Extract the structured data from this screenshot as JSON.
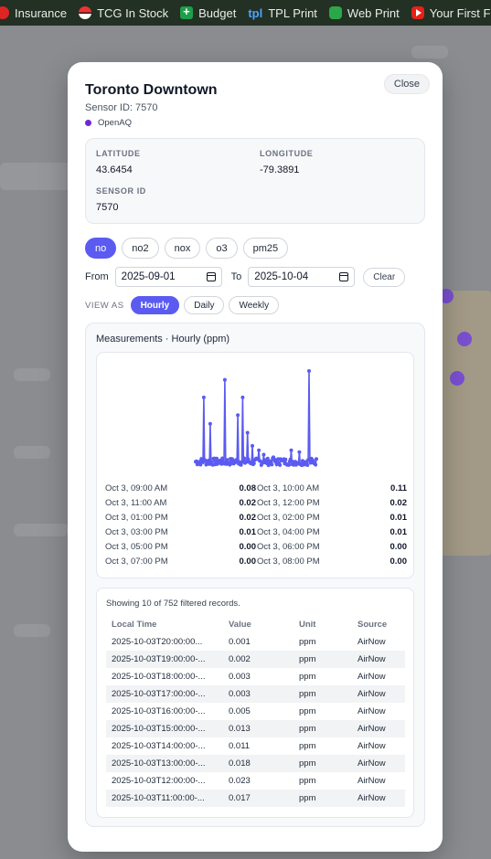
{
  "bookmarks": [
    {
      "label": "Insurance",
      "icon": "red-circle-icon"
    },
    {
      "label": "TCG In Stock",
      "icon": "pokeball-icon"
    },
    {
      "label": "Budget",
      "icon": "sheets-icon"
    },
    {
      "label": "TPL Print",
      "icon": "tpl-icon"
    },
    {
      "label": "Web Print",
      "icon": "web-print-icon"
    },
    {
      "label": "Your First F",
      "icon": "youtube-icon"
    }
  ],
  "modal": {
    "title": "Toronto Downtown",
    "sensor_id_text": "Sensor ID: 7570",
    "source": "OpenAQ",
    "close_label": "Close",
    "latitude_label": "LATITUDE",
    "latitude": "43.6454",
    "longitude_label": "LONGITUDE",
    "longitude": "-79.3891",
    "sensor_id_label": "SENSOR ID",
    "sensor_id": "7570"
  },
  "pollutants": [
    "no",
    "no2",
    "nox",
    "o3",
    "pm25"
  ],
  "active_pollutant": "no",
  "dates": {
    "from_label": "From",
    "from": "2025-09-01",
    "to_label": "To",
    "to": "2025-10-04",
    "clear_label": "Clear"
  },
  "view": {
    "label": "VIEW AS",
    "options": [
      "Hourly",
      "Daily",
      "Weekly"
    ],
    "active": "Hourly"
  },
  "measurements_title": "Measurements · Hourly (ppm)",
  "chart_data": {
    "type": "line",
    "series_color": "#5b5bf2",
    "peaks": [
      0.11,
      0.08,
      0.1,
      0.08,
      0.05,
      0.03,
      0.11,
      0.06
    ],
    "baseline": 0.003
  },
  "readings": [
    [
      "Oct 3, 09:00 AM",
      "0.08",
      "Oct 3, 10:00 AM",
      "0.11"
    ],
    [
      "Oct 3, 11:00 AM",
      "0.02",
      "Oct 3, 12:00 PM",
      "0.02"
    ],
    [
      "Oct 3, 01:00 PM",
      "0.02",
      "Oct 3, 02:00 PM",
      "0.01"
    ],
    [
      "Oct 3, 03:00 PM",
      "0.01",
      "Oct 3, 04:00 PM",
      "0.01"
    ],
    [
      "Oct 3, 05:00 PM",
      "0.00",
      "Oct 3, 06:00 PM",
      "0.00"
    ],
    [
      "Oct 3, 07:00 PM",
      "0.00",
      "Oct 3, 08:00 PM",
      "0.00"
    ]
  ],
  "table": {
    "count_text": "Showing 10 of 752 filtered records.",
    "headers": [
      "Local Time",
      "Value",
      "Unit",
      "Source"
    ],
    "rows": [
      [
        "2025-10-03T20:00:00...",
        "0.001",
        "ppm",
        "AirNow"
      ],
      [
        "2025-10-03T19:00:00-...",
        "0.002",
        "ppm",
        "AirNow"
      ],
      [
        "2025-10-03T18:00:00-...",
        "0.003",
        "ppm",
        "AirNow"
      ],
      [
        "2025-10-03T17:00:00-...",
        "0.003",
        "ppm",
        "AirNow"
      ],
      [
        "2025-10-03T16:00:00-...",
        "0.005",
        "ppm",
        "AirNow"
      ],
      [
        "2025-10-03T15:00:00-...",
        "0.013",
        "ppm",
        "AirNow"
      ],
      [
        "2025-10-03T14:00:00-...",
        "0.011",
        "ppm",
        "AirNow"
      ],
      [
        "2025-10-03T13:00:00-...",
        "0.018",
        "ppm",
        "AirNow"
      ],
      [
        "2025-10-03T12:00:00-...",
        "0.023",
        "ppm",
        "AirNow"
      ],
      [
        "2025-10-03T11:00:00-...",
        "0.017",
        "ppm",
        "AirNow"
      ]
    ]
  }
}
